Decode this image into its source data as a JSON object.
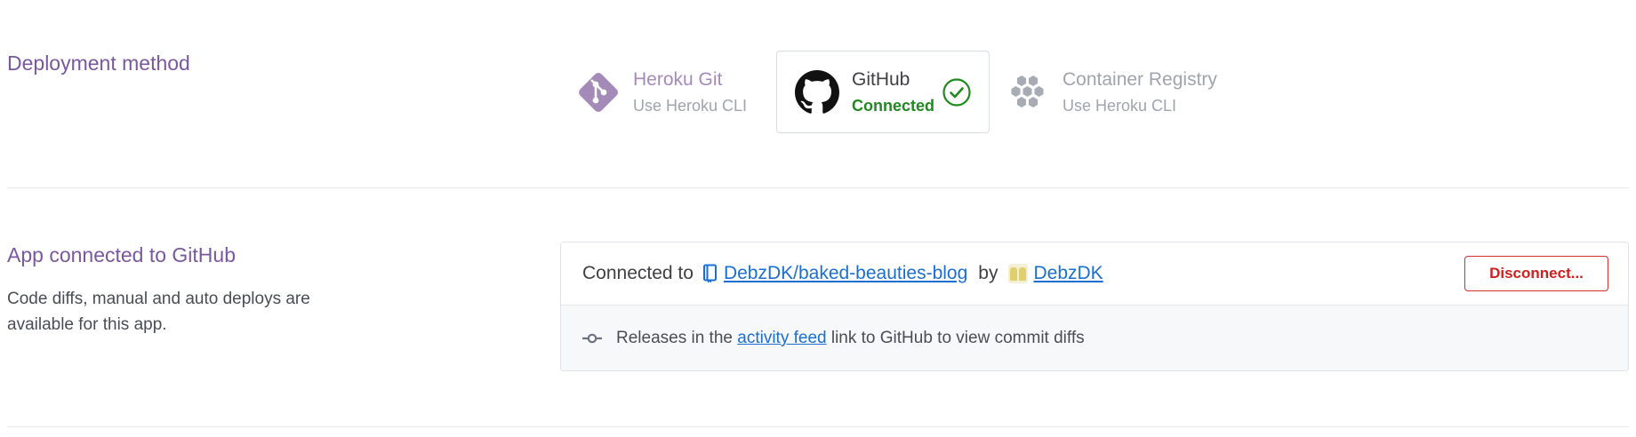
{
  "deployment": {
    "heading": "Deployment method",
    "methods": [
      {
        "title": "Heroku Git",
        "subtitle": "Use Heroku CLI",
        "icon": "git-diamond-icon"
      },
      {
        "title": "GitHub",
        "status": "Connected",
        "icon": "github-octocat-icon",
        "status_icon": "check-circle-icon",
        "selected": true
      },
      {
        "title": "Container Registry",
        "subtitle": "Use Heroku CLI",
        "icon": "hexagon-cluster-icon"
      }
    ]
  },
  "connected": {
    "heading": "App connected to GitHub",
    "description": "Code diffs, manual and auto deploys are available for this app.",
    "connected_to_label": "Connected to",
    "repo": "DebzDK/baked-beauties-blog",
    "by_label": "by",
    "user": "DebzDK",
    "disconnect_label": "Disconnect...",
    "feed_prefix": "Releases in the",
    "feed_link": "activity feed",
    "feed_suffix": "link to GitHub to view commit diffs"
  },
  "colors": {
    "brand_purple": "#79589f",
    "link_blue": "#1a6fd1",
    "success_green": "#1f8a1f",
    "danger_red": "#cf1f1f"
  }
}
